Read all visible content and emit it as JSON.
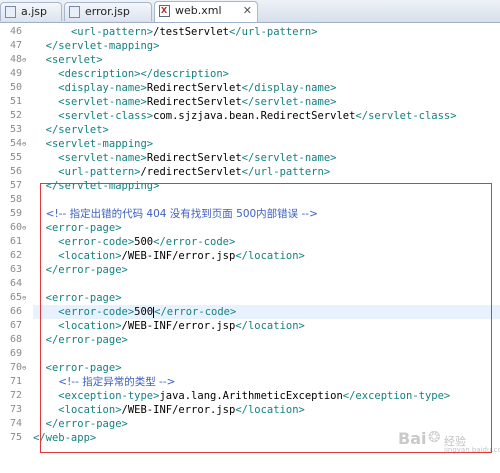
{
  "tabs": [
    {
      "label": "a.jsp",
      "icon": "jsp-file-icon",
      "active": false
    },
    {
      "label": "error.jsp",
      "icon": "jsp-file-icon",
      "active": false
    },
    {
      "label": "web.xml",
      "icon": "xml-file-icon",
      "active": true,
      "close": "✕"
    }
  ],
  "editor": {
    "line_numbers": [
      "46",
      "47",
      "48",
      "49",
      "50",
      "51",
      "52",
      "53",
      "54",
      "55",
      "56",
      "57",
      "58",
      "59",
      "60",
      "61",
      "62",
      "63",
      "64",
      "65",
      "66",
      "67",
      "68",
      "69",
      "70",
      "71",
      "72",
      "73",
      "74",
      "75"
    ],
    "fold_markers": {
      "48": "⊖",
      "54": "⊖",
      "60": "⊖",
      "65": "⊖",
      "70": "⊖"
    },
    "lines": {
      "l46": {
        "open": "<url-pattern>",
        "text": "/testServlet",
        "close": "</url-pattern>"
      },
      "l47": "</servlet-mapping>",
      "l48": "<servlet>",
      "l49": "<description></description>",
      "l50": {
        "open": "<display-name>",
        "text": "RedirectServlet",
        "close": "</display-name>"
      },
      "l51": {
        "open": "<servlet-name>",
        "text": "RedirectServlet",
        "close": "</servlet-name>"
      },
      "l52": {
        "open": "<servlet-class>",
        "text": "com.sjzjava.bean.RedirectServlet",
        "close": "</servlet-class>"
      },
      "l53": "</servlet>",
      "l54": "<servlet-mapping>",
      "l55": {
        "open": "<servlet-name>",
        "text": "RedirectServlet",
        "close": "</servlet-name>"
      },
      "l56": {
        "open": "<url-pattern>",
        "text": "/redirectServlet",
        "close": "</url-pattern>"
      },
      "l57": "</servlet-mapping>",
      "l59": "<!-- 指定出错的代码 404 没有找到页面 500内部错误 -->",
      "l60": "<error-page>",
      "l61": {
        "open": "<error-code>",
        "text": "500",
        "close": "</error-code>"
      },
      "l62": {
        "open": "<location>",
        "text": "/WEB-INF/error.jsp",
        "close": "</location>"
      },
      "l63": "</error-page>",
      "l65": "<error-page>",
      "l66": {
        "open": "<error-code>",
        "text": "500",
        "close": "</error-code>"
      },
      "l67": {
        "open": "<location>",
        "text": "/WEB-INF/error.jsp",
        "close": "</location>"
      },
      "l68": "</error-page>",
      "l70": "<error-page>",
      "l71": "<!-- 指定异常的类型 -->",
      "l72": {
        "open": "<exception-type>",
        "text": "java.lang.ArithmeticException",
        "close": "</exception-type>"
      },
      "l73": {
        "open": "<location>",
        "text": "/WEB-INF/error.jsp",
        "close": "</location>"
      },
      "l74": "</error-page>",
      "l75": "</web-app>"
    }
  },
  "watermark": {
    "brand": "Bai",
    "paw": "❂",
    "suffix": "经验",
    "url": "jingyan.baidu.com"
  }
}
